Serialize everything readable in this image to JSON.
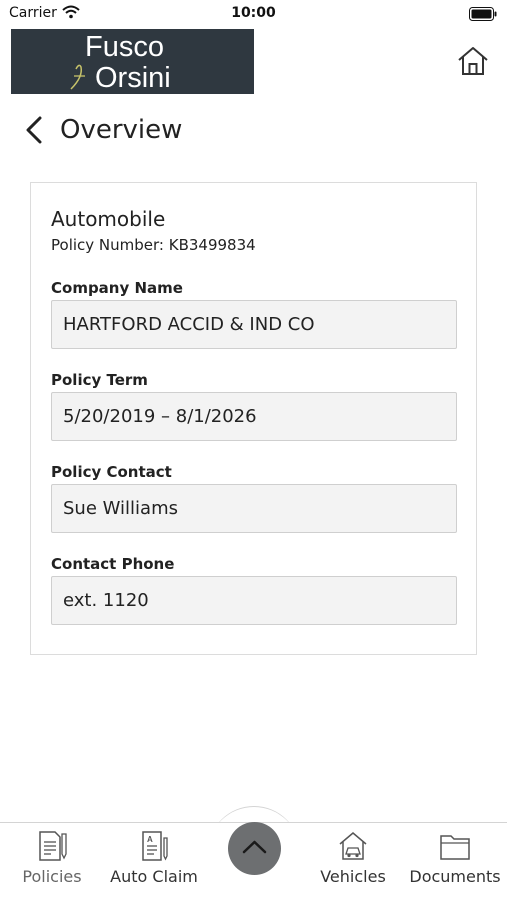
{
  "status_bar": {
    "carrier": "Carrier",
    "time": "10:00"
  },
  "header": {
    "logo_line1": "Fusco",
    "logo_amp": "f",
    "logo_line2": "Orsini",
    "home_icon": "home-icon"
  },
  "nav": {
    "back_icon": "chevron-left-icon",
    "title": "Overview"
  },
  "policy": {
    "type": "Automobile",
    "number_line": "Policy Number: KB3499834",
    "fields": [
      {
        "label": "Company Name",
        "value": "HARTFORD ACCID & IND CO"
      },
      {
        "label": "Policy Term",
        "value": "5/20/2019 – 8/1/2026"
      },
      {
        "label": "Policy Contact",
        "value": "Sue Williams"
      },
      {
        "label": "Contact Phone",
        "value": "ext. 1120"
      }
    ]
  },
  "tab_bar": {
    "tabs": [
      {
        "label": "Policies",
        "icon": "policies-icon"
      },
      {
        "label": "Auto Claim",
        "icon": "auto-claim-icon"
      },
      {
        "label": "Vehicles",
        "icon": "vehicles-icon"
      },
      {
        "label": "Documents",
        "icon": "documents-icon"
      }
    ],
    "center_icon": "chevron-up-icon"
  },
  "colors": {
    "logo_bg": "#2f3840",
    "field_bg": "#f3f3f3",
    "center_button": "#6d6f71"
  }
}
